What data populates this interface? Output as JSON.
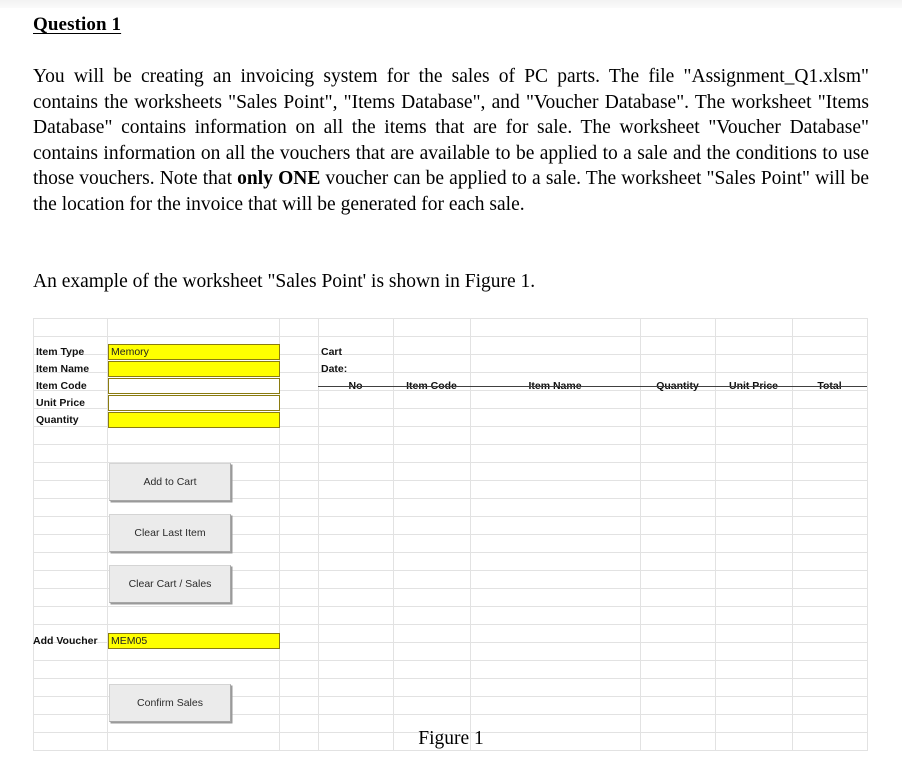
{
  "document": {
    "heading": "Question 1",
    "paragraph_1": "You will be creating an invoicing system for the sales of PC parts. The file \"Assignment_Q1.xlsm\"   contains the worksheets \"Sales Point\", \"Items Database\", and \"Voucher Database\". The worksheet \"Items Database\" contains information on all the items that are for sale. The worksheet \"Voucher Database\" contains information on all the vouchers that are available to be applied to a sale and the conditions to use those vouchers. Note that ",
    "paragraph_1_bold": "only ONE",
    "paragraph_1_cont": " voucher can be applied to a sale. The worksheet \"Sales Point\" will be the location for the invoice that will be generated for each sale.",
    "paragraph_2": "An example of the worksheet \"Sales Point' is shown in Figure 1.",
    "figure_caption": "Figure 1"
  },
  "spreadsheet": {
    "input_panel": {
      "rows": [
        {
          "label": "Item Type",
          "value": "Memory",
          "highlight": true
        },
        {
          "label": "Item Name",
          "value": "",
          "highlight": true
        },
        {
          "label": "Item Code",
          "value": "",
          "highlight": false
        },
        {
          "label": "Unit Price",
          "value": "",
          "highlight": false
        },
        {
          "label": "Quantity",
          "value": "",
          "highlight": true
        }
      ]
    },
    "buttons": [
      {
        "label": "Add to Cart"
      },
      {
        "label": "Clear Last Item"
      },
      {
        "label": "Clear Cart / Sales"
      },
      {
        "label": "Confirm Sales"
      }
    ],
    "voucher": {
      "label": "Add Voucher",
      "value": "MEM05",
      "highlight": true
    },
    "cart": {
      "title": "Cart",
      "date_label": "Date:",
      "date_value": "",
      "columns": [
        "No",
        "Item Code",
        "Item Name",
        "Quantity",
        "Unit Price",
        "Total"
      ],
      "rows": []
    },
    "colors": {
      "highlight": "#FFFF00",
      "grid_line": "#E2E2E2",
      "button_face": "#EBEBEB",
      "header_rule": "#404040"
    }
  }
}
